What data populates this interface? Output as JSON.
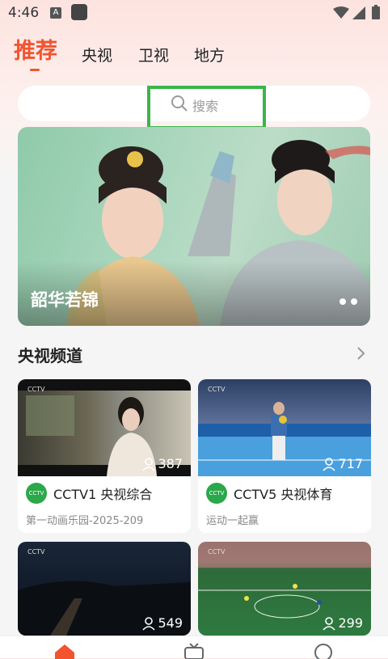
{
  "status": {
    "time": "4:46",
    "badge": "A"
  },
  "tabs": [
    {
      "label": "推荐"
    },
    {
      "label": "央视"
    },
    {
      "label": "卫视"
    },
    {
      "label": "地方"
    }
  ],
  "search": {
    "placeholder": "搜索"
  },
  "banner": {
    "title": "韶华若锦"
  },
  "section": {
    "title": "央视频道"
  },
  "cards": [
    {
      "channel": "CCTV1 央视综合",
      "program": "第一动画乐园-2025-209",
      "viewers": "387",
      "logo": "CCTV"
    },
    {
      "channel": "CCTV5 央视体育",
      "program": "运动一起赢",
      "viewers": "717",
      "logo": "CCTV"
    },
    {
      "channel": "",
      "program": "",
      "viewers": "549",
      "logo": "CCTV"
    },
    {
      "channel": "",
      "program": "",
      "viewers": "299",
      "logo": "CCTV"
    }
  ],
  "colors": {
    "accent": "#f2542f",
    "highlight": "#3cb54a",
    "channel_logo": "#2aa84a"
  }
}
